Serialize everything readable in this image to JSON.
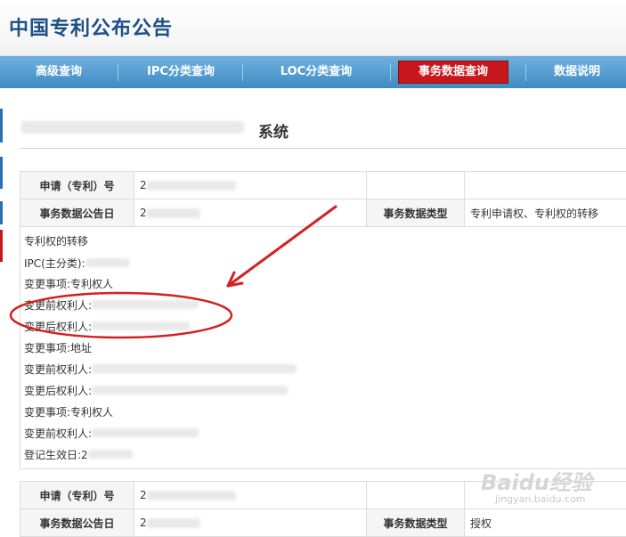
{
  "header": {
    "title": "中国专利公布公告"
  },
  "nav": {
    "items": [
      "高级查询",
      "IPC分类查询",
      "LOC分类查询",
      "事务数据查询",
      "数据说明"
    ],
    "active_index": 3
  },
  "system": {
    "title_suffix": "系统"
  },
  "record1": {
    "app_no_label": "申请（专利）号",
    "app_no_value": "2",
    "pub_date_label": "事务数据公告日",
    "pub_date_value": "2",
    "type_label": "事务数据类型",
    "type_value": "专利申请权、专利权的转移"
  },
  "detail_lines": [
    "专利权的转移",
    "IPC(主分类):",
    "变更事项:专利权人",
    "变更前权利人:",
    "变更后权利人:",
    "变更事项:地址",
    "变更前权利人:",
    "变更后权利人:",
    "变更事项:专利权人",
    "变更前权利人:",
    "登记生效日:2"
  ],
  "record2": {
    "app_no_label": "申请（专利）号",
    "app_no_value": "2",
    "pub_date_label": "事务数据公告日",
    "pub_date_value": "2",
    "type_label": "事务数据类型",
    "type_value": "授权"
  },
  "watermark": {
    "brand": "Baidu经验",
    "url": "jingyan.baidu.com"
  },
  "colors": {
    "nav": "#4f9bd0",
    "active": "#c8161d",
    "title": "#1c4f86",
    "annotation": "#d42020"
  }
}
